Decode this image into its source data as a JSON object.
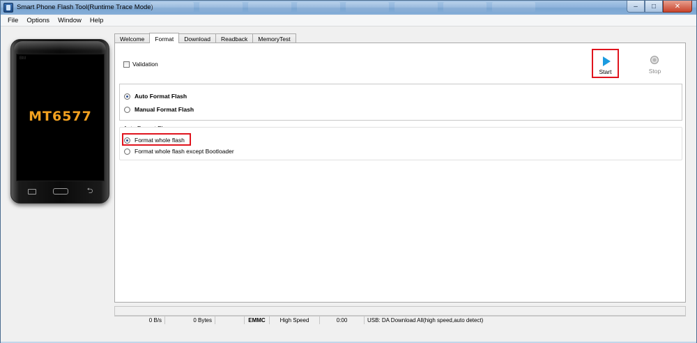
{
  "window": {
    "title": "Smart Phone Flash Tool(Runtime Trace Mode)",
    "controls": {
      "minimize": "–",
      "maximize": "□",
      "close": "✕"
    }
  },
  "menu": [
    "File",
    "Options",
    "Window",
    "Help"
  ],
  "phone": {
    "model": "MT6577",
    "brand": "BM",
    "icons": {
      "menu": "menu-key-icon",
      "home": "home-key-icon",
      "back": "back-key-icon"
    },
    "back_glyph": "⮌"
  },
  "tabs": [
    "Welcome",
    "Format",
    "Download",
    "Readback",
    "MemoryTest"
  ],
  "active_tab": "Format",
  "format": {
    "validation_label": "Validation",
    "validation_checked": false,
    "start_label": "Start",
    "stop_label": "Stop",
    "mode_options": [
      {
        "label": "Auto Format Flash",
        "selected": true
      },
      {
        "label": "Manual Format Flash",
        "selected": false
      }
    ],
    "flag_group_title": "Auto Format Flag",
    "flag_options": [
      {
        "label": "Format whole flash",
        "selected": true
      },
      {
        "label": "Format whole flash except Bootloader",
        "selected": false
      }
    ]
  },
  "status": {
    "speed": "0 B/s",
    "bytes": "0 Bytes",
    "storage": "EMMC",
    "mode": "High Speed",
    "time": "0:00",
    "usb": "USB: DA Download All(high speed,auto detect)"
  },
  "colors": {
    "highlight": "#e0141e",
    "play": "#1b9be0",
    "model_text": "#f2a120"
  }
}
